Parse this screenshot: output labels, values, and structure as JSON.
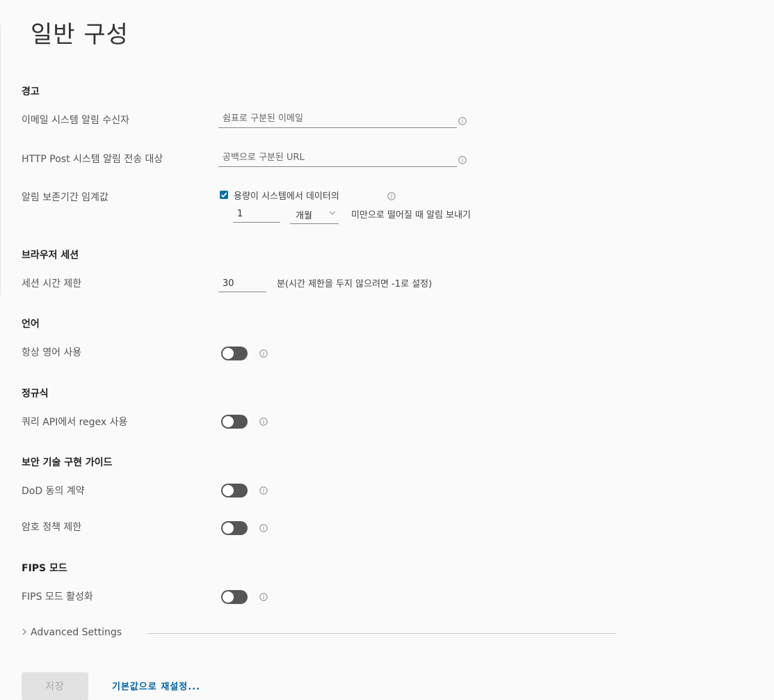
{
  "page": {
    "title": "일반 구성"
  },
  "alerts": {
    "section_title": "경고",
    "email_label": "이메일 시스템 알림 수신자",
    "email_placeholder": "쉼표로 구분된 이메일",
    "http_label": "HTTP Post 시스템 알림 전송 대상",
    "http_placeholder": "공백으로 구분된 URL",
    "retention_label": "알림 보존기간 임계값",
    "retention_checkbox_label": "용량이 시스템에서 데이터의",
    "retention_checked": true,
    "retention_value": "1",
    "retention_unit": "개월",
    "retention_suffix": "미만으로 떨어질 때 알림 보내기"
  },
  "browser_session": {
    "section_title": "브라우저 세션",
    "timeout_label": "세션 시간 제한",
    "timeout_value": "30",
    "timeout_suffix": "분(시간 제한을 두지 않으려면 -1로 설정)"
  },
  "language": {
    "section_title": "언어",
    "always_english_label": "항상 영어 사용",
    "always_english_enabled": false
  },
  "regex": {
    "section_title": "정규식",
    "query_api_label": "쿼리 API에서 regex 사용",
    "query_api_enabled": false
  },
  "stig": {
    "section_title": "보안 기술 구현 가이드",
    "dod_label": "DoD 동의 계약",
    "dod_enabled": false,
    "password_label": "암호 정책 제한",
    "password_enabled": false
  },
  "fips": {
    "section_title": "FIPS 모드",
    "enable_label": "FIPS 모드 활성화",
    "enable_enabled": false
  },
  "advanced": {
    "label": "Advanced Settings"
  },
  "footer": {
    "save_label": "저장",
    "reset_label": "기본값으로 재설정..."
  },
  "colors": {
    "accent": "#0072a3",
    "link": "#0062a8",
    "toggle_off": "#565656"
  },
  "icons": {
    "info": "info-icon",
    "check": "check-icon",
    "caret": "chevron-down-icon",
    "expand": "chevron-right-icon"
  }
}
